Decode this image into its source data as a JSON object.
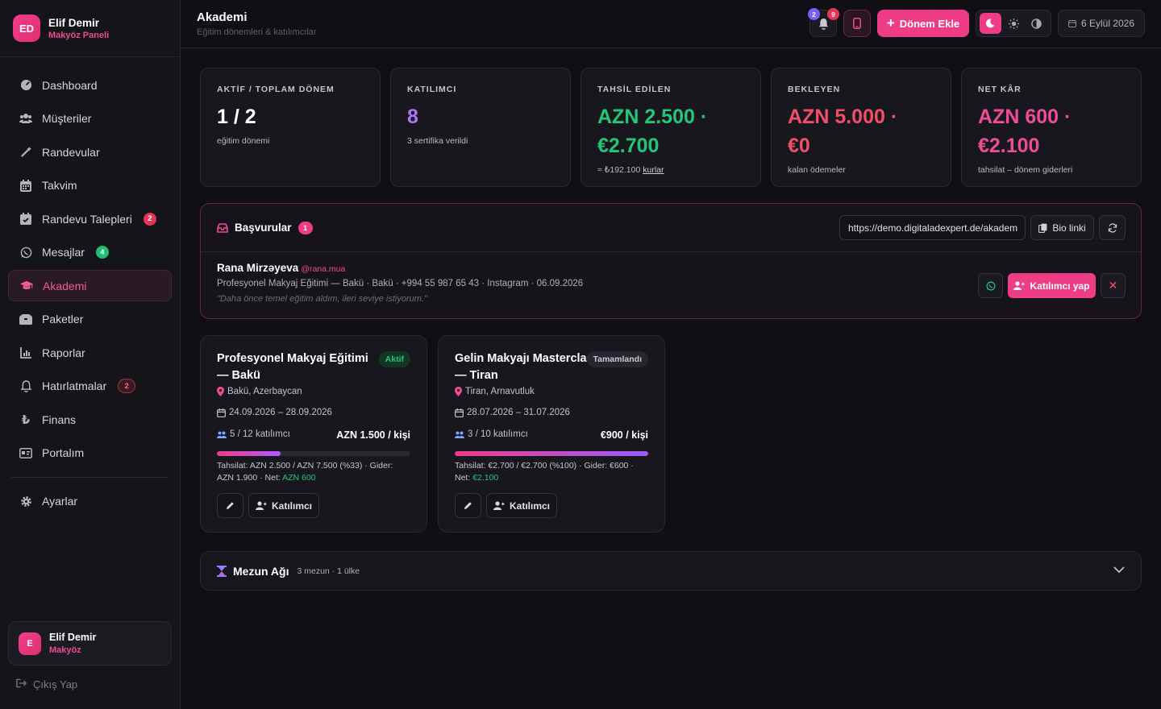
{
  "sidebar": {
    "user": {
      "initials": "ED",
      "name": "Elif Demir",
      "role": "Makyöz Paneli"
    },
    "items": [
      {
        "label": "Dashboard",
        "icon": "dashboard-icon"
      },
      {
        "label": "Müşteriler",
        "icon": "users-icon"
      },
      {
        "label": "Randevular",
        "icon": "magic-wand-icon"
      },
      {
        "label": "Takvim",
        "icon": "calendar-icon"
      },
      {
        "label": "Randevu Talepleri",
        "icon": "calendar-check-icon",
        "badge": "2"
      },
      {
        "label": "Mesajlar",
        "icon": "whatsapp-icon",
        "badge": "4"
      },
      {
        "label": "Akademi",
        "icon": "graduation-cap-icon"
      },
      {
        "label": "Paketler",
        "icon": "box-icon"
      },
      {
        "label": "Raporlar",
        "icon": "chart-icon"
      },
      {
        "label": "Hatırlatmalar",
        "icon": "bell-icon",
        "badge": "2"
      },
      {
        "label": "Finans",
        "icon": "lira-icon"
      },
      {
        "label": "Portalım",
        "icon": "id-card-icon"
      },
      {
        "label": "Ayarlar",
        "icon": "gear-icon"
      }
    ],
    "footer_user": {
      "initial": "E",
      "name": "Elif Demir",
      "role": "Makyöz"
    },
    "logout": "Çıkış Yap"
  },
  "header": {
    "title": "Akademi",
    "subtitle": "Eğitim dönemleri & katılımcılar",
    "notif_badge_1": "2",
    "notif_badge_2": "9",
    "add_button": "Dönem Ekle",
    "date": "6 Eylül 2026"
  },
  "stats": [
    {
      "label": "AKTİF / TOPLAM DÖNEM",
      "value": "1 / 2",
      "sub": "eğitim dönemi",
      "color": "#ffffff"
    },
    {
      "label": "KATILIMCI",
      "value": "8",
      "sub": "3 sertifika verildi",
      "color": "#a776ff"
    },
    {
      "label": "TAHSİL EDİLEN",
      "value_1": "AZN 2.500 ·",
      "value_2": "€2.700",
      "sub": "≈ ₺192.100",
      "sub_link": "kurlar",
      "color": "#22c77a"
    },
    {
      "label": "BEKLEYEN",
      "value_1": "AZN 5.000 ·",
      "value_2": "€0",
      "sub": "kalan ödemeler",
      "color": "#f24e6c"
    },
    {
      "label": "NET KÂR",
      "value_1": "AZN 600 ·",
      "value_2": "€2.100",
      "sub": "tahsilat – dönem giderleri",
      "color": "#ef4d96"
    }
  ],
  "applications": {
    "title": "Başvurular",
    "count": "1",
    "url": "https://demo.digitaladexpert.de/akadem",
    "bio_button": "Bio linki",
    "entry": {
      "name": "Rana Mirzəyeva",
      "handle": "@rana.mua",
      "details": "Profesyonel Makyaj Eğitimi — Bakü · Bakü · +994 55 987 65 43 · Instagram · 06.09.2026",
      "quote": "\"Daha önce temel eğitim aldım, ileri seviye istiyorum.\"",
      "accept_button": "Katılımcı yap"
    }
  },
  "courses": [
    {
      "title": "Profesyonel Makyaj Eğitimi — Bakü",
      "status": "Aktif",
      "location": "Bakü, Azerbaycan",
      "dates": "24.09.2026 – 28.09.2026",
      "participants": "5 / 12 katılımcı",
      "price": "AZN 1.500 / kişi",
      "progress": 0.33,
      "note": "Tahsilat: AZN 2.500 / AZN 7.500 (%33) · Gider: AZN 1.900 · Net: ",
      "net": "AZN 600",
      "participant_button": "Katılımcı"
    },
    {
      "title": "Gelin Makyajı Masterclass — Tiran",
      "status": "Tamamlandı",
      "location": "Tiran, Arnavutluk",
      "dates": "28.07.2026 – 31.07.2026",
      "participants": "3 / 10 katılımcı",
      "price": "€900 / kişi",
      "progress": 1.0,
      "note": "Tahsilat: €2.700 / €2.700 (%100) · Gider: €600 · Net: ",
      "net": "€2.100",
      "participant_button": "Katılımcı"
    }
  ],
  "graduates": {
    "title": "Mezun Ağı",
    "meta": "3 mezun · 1 ülke"
  },
  "colors": {
    "accent": "#ef3c86",
    "green": "#22c77a",
    "red": "#f24e6c",
    "purple": "#a776ff"
  }
}
